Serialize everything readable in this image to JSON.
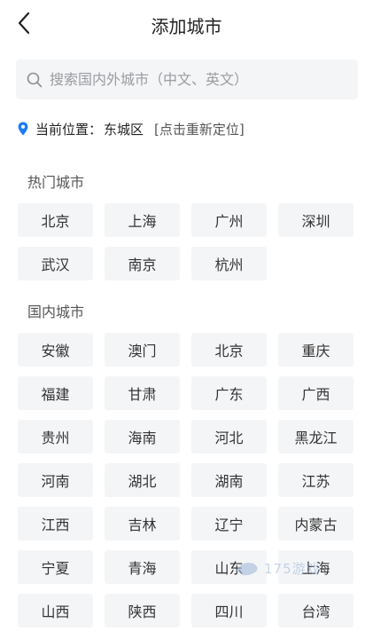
{
  "header": {
    "title": "添加城市",
    "back_icon": "chevron-left-icon"
  },
  "search": {
    "placeholder": "搜索国内外城市（中文、英文）",
    "icon": "search-icon"
  },
  "location": {
    "label": "当前位置：",
    "city": "东城区",
    "action": "[点击重新定位]",
    "icon_color": "#1e7cf5"
  },
  "hot": {
    "title": "热门城市",
    "cities": [
      "北京",
      "上海",
      "广州",
      "深圳",
      "武汉",
      "南京",
      "杭州"
    ]
  },
  "domestic": {
    "title": "国内城市",
    "cities": [
      "安徽",
      "澳门",
      "北京",
      "重庆",
      "福建",
      "甘肃",
      "广东",
      "广西",
      "贵州",
      "海南",
      "河北",
      "黑龙江",
      "河南",
      "湖北",
      "湖南",
      "江苏",
      "江西",
      "吉林",
      "辽宁",
      "内蒙古",
      "宁夏",
      "青海",
      "山东",
      "上海",
      "山西",
      "陕西",
      "四川",
      "台湾"
    ]
  },
  "watermark": {
    "text": "175游戏"
  }
}
